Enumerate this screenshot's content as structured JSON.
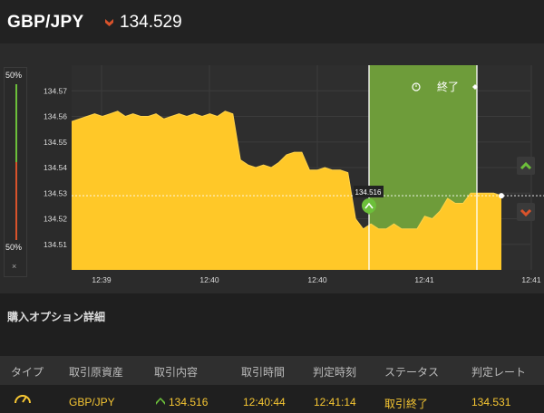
{
  "header": {
    "pair": "GBP/JPY",
    "price": "134.529"
  },
  "ratio": {
    "top": "50%",
    "bottom": "50%",
    "close": "×"
  },
  "chart": {
    "current_price": 134.529,
    "entry_price_label": "134.516",
    "end_label": "終了",
    "y_ticks": [
      "134.57",
      "134.56",
      "134.55",
      "134.54",
      "134.53",
      "134.52",
      "134.51"
    ],
    "x_ticks": [
      "12:39",
      "12:40",
      "12:40",
      "12:41",
      "12:41"
    ]
  },
  "chart_data": {
    "type": "area",
    "ylim": [
      134.5,
      134.58
    ],
    "series": [
      {
        "values": [
          134.558,
          134.559,
          134.56,
          134.561,
          134.56,
          134.561,
          134.562,
          134.56,
          134.561,
          134.56,
          134.56,
          134.561,
          134.559,
          134.56,
          134.561,
          134.56,
          134.561,
          134.56,
          134.561,
          134.56,
          134.562,
          134.561,
          134.543,
          134.541,
          134.54,
          134.541,
          134.54,
          134.542,
          134.545,
          134.546,
          134.546,
          134.539,
          134.539,
          134.54,
          134.539,
          134.539,
          134.538,
          134.52,
          134.516,
          134.518,
          134.516,
          134.516,
          134.518,
          134.516,
          134.516,
          134.516,
          134.521,
          134.52,
          134.523,
          134.528,
          134.526,
          134.526,
          134.53,
          134.53,
          134.53,
          134.53,
          134.529
        ]
      }
    ]
  },
  "details": {
    "title": "購入オプション詳細",
    "columns": [
      "タイプ",
      "取引原資産",
      "取引内容",
      "取引時間",
      "判定時刻",
      "ステータス",
      "判定レート"
    ],
    "row": {
      "asset": "GBP/JPY",
      "content": "134.516",
      "trade_time": "12:40:44",
      "judge_time": "12:41:14",
      "status": "取引終了",
      "rate": "134.531"
    }
  },
  "colors": {
    "up": "#6cbf3a",
    "down": "#d9532b",
    "area": "#ffc828",
    "win_zone": "#6e9c3a",
    "value_text": "#f7c733"
  },
  "icons": {
    "down_arrow": "chevron-down-icon",
    "up_arrow": "chevron-up-icon",
    "timer": "timer-icon",
    "option_type": "gauge-icon"
  }
}
